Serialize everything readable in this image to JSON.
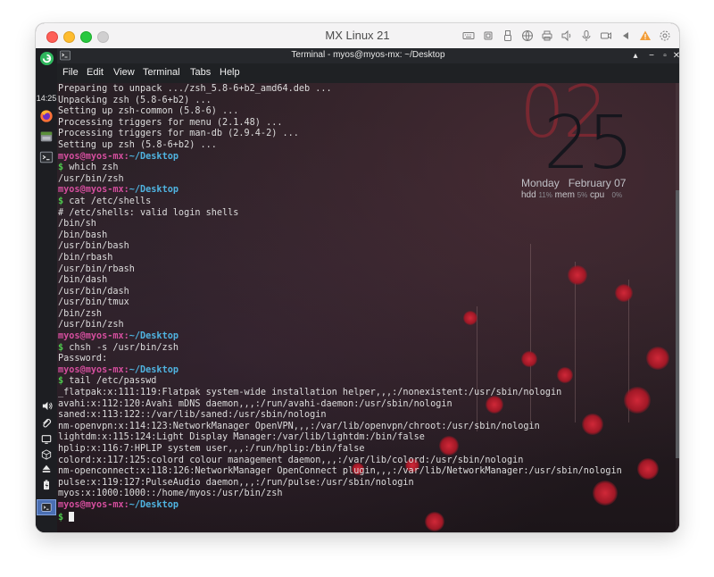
{
  "vm": {
    "title": "MX Linux 21",
    "toolbar_icons": [
      "keyboard-icon",
      "chip-icon",
      "usb-icon",
      "network-icon",
      "printer-icon",
      "speaker-icon",
      "microphone-icon",
      "camera-icon",
      "play-icon",
      "warning-icon",
      "gear-icon"
    ]
  },
  "panel": {
    "clock": "14:25",
    "launchers": [
      "mx-logo-icon",
      "firefox-icon",
      "file-manager-icon",
      "terminal-launcher-icon"
    ],
    "tray_icons": [
      "volume-icon",
      "clip-icon",
      "monitor-icon",
      "package-icon",
      "eject-icon",
      "battery-icon"
    ],
    "active_task": "terminal-task-icon",
    "bottom_icon": "x-logo-icon"
  },
  "terminal": {
    "title": "Terminal - myos@myos-mx: ~/Desktop",
    "menu": [
      "File",
      "Edit",
      "View",
      "Terminal",
      "Tabs",
      "Help"
    ],
    "user": "myos",
    "at": "@",
    "host": "myos-mx",
    "colon": ":",
    "path": "~/Desktop",
    "dollar": "$",
    "lines": [
      {
        "t": "out",
        "text": "Preparing to unpack .../zsh_5.8-6+b2_amd64.deb ..."
      },
      {
        "t": "out",
        "text": "Unpacking zsh (5.8-6+b2) ..."
      },
      {
        "t": "out",
        "text": "Setting up zsh-common (5.8-6) ..."
      },
      {
        "t": "out",
        "text": "Processing triggers for menu (2.1.48) ..."
      },
      {
        "t": "out",
        "text": "Processing triggers for man-db (2.9.4-2) ..."
      },
      {
        "t": "out",
        "text": "Setting up zsh (5.8-6+b2) ..."
      },
      {
        "t": "prompt"
      },
      {
        "t": "cmd",
        "text": "which zsh"
      },
      {
        "t": "out",
        "text": "/usr/bin/zsh"
      },
      {
        "t": "prompt"
      },
      {
        "t": "cmd",
        "text": "cat /etc/shells"
      },
      {
        "t": "out",
        "text": "# /etc/shells: valid login shells"
      },
      {
        "t": "out",
        "text": "/bin/sh"
      },
      {
        "t": "out",
        "text": "/bin/bash"
      },
      {
        "t": "out",
        "text": "/usr/bin/bash"
      },
      {
        "t": "out",
        "text": "/bin/rbash"
      },
      {
        "t": "out",
        "text": "/usr/bin/rbash"
      },
      {
        "t": "out",
        "text": "/bin/dash"
      },
      {
        "t": "out",
        "text": "/usr/bin/dash"
      },
      {
        "t": "out",
        "text": "/usr/bin/tmux"
      },
      {
        "t": "out",
        "text": "/bin/zsh"
      },
      {
        "t": "out",
        "text": "/usr/bin/zsh"
      },
      {
        "t": "prompt"
      },
      {
        "t": "cmd",
        "text": "chsh -s /usr/bin/zsh"
      },
      {
        "t": "out",
        "text": "Password:"
      },
      {
        "t": "prompt"
      },
      {
        "t": "cmd",
        "text": "tail /etc/passwd"
      },
      {
        "t": "out",
        "text": "_flatpak:x:111:119:Flatpak system-wide installation helper,,,:/nonexistent:/usr/sbin/nologin"
      },
      {
        "t": "out",
        "text": "avahi:x:112:120:Avahi mDNS daemon,,,:/run/avahi-daemon:/usr/sbin/nologin"
      },
      {
        "t": "out",
        "text": "saned:x:113:122::/var/lib/saned:/usr/sbin/nologin"
      },
      {
        "t": "out",
        "text": "nm-openvpn:x:114:123:NetworkManager OpenVPN,,,:/var/lib/openvpn/chroot:/usr/sbin/nologin"
      },
      {
        "t": "out",
        "text": "lightdm:x:115:124:Light Display Manager:/var/lib/lightdm:/bin/false"
      },
      {
        "t": "out",
        "text": "hplip:x:116:7:HPLIP system user,,,:/run/hplip:/bin/false"
      },
      {
        "t": "out",
        "text": "colord:x:117:125:colord colour management daemon,,,:/var/lib/colord:/usr/sbin/nologin"
      },
      {
        "t": "out",
        "text": "nm-openconnect:x:118:126:NetworkManager OpenConnect plugin,,,:/var/lib/NetworkManager:/usr/sbin/nologin"
      },
      {
        "t": "out",
        "text": "pulse:x:119:127:PulseAudio daemon,,,:/run/pulse:/usr/sbin/nologin"
      },
      {
        "t": "out",
        "text": "myos:x:1000:1000::/home/myos:/usr/bin/zsh"
      },
      {
        "t": "prompt"
      },
      {
        "t": "input"
      }
    ]
  },
  "conky": {
    "hour": "02",
    "minute": "25",
    "day": "Monday",
    "date": "February 07",
    "hdd_label": "hdd",
    "hdd_val": "11%",
    "mem_label": "mem",
    "mem_val": "5%",
    "cpu_label": "cpu",
    "cpu_val": "0%"
  },
  "colors": {
    "prompt_user": "#d54e9e",
    "prompt_path": "#4fb3e0",
    "prompt_dollar": "#4ec94e",
    "text": "#dcdcdc"
  }
}
